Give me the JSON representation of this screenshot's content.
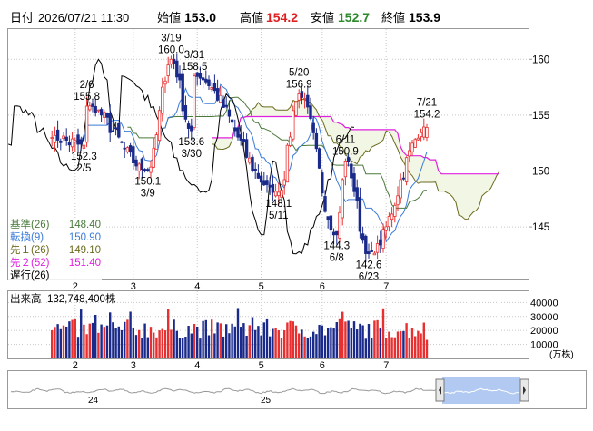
{
  "header": {
    "date_label": "日付",
    "datetime": "2026/07/21 11:30",
    "open_label": "始値",
    "open": "153.0",
    "high_label": "高値",
    "high": "154.2",
    "low_label": "安値",
    "low": "152.7",
    "close_label": "終値",
    "close": "153.9"
  },
  "legend": [
    {
      "label": "基準(26)",
      "value": "148.40",
      "color": "#4a7a3a"
    },
    {
      "label": "転換(9)",
      "value": "150.90",
      "color": "#3a7ad8"
    },
    {
      "label": "先１(26)",
      "value": "149.10",
      "color": "#6b6b1e"
    },
    {
      "label": "先２(52)",
      "value": "151.40",
      "color": "#e020e0"
    },
    {
      "label": "遅行(26)",
      "value": "",
      "color": "#000000"
    }
  ],
  "volume_header": {
    "label": "出来高",
    "value": "132,748,400株"
  },
  "volume_unit": "(万株)",
  "navigator_labels": [
    "24",
    "25"
  ],
  "colors": {
    "up": "#e83030",
    "down": "#1a2a8a",
    "base": "#4a7a3a",
    "conversion": "#3a7ad8",
    "span1": "#6b6b1e",
    "span2": "#e020e0",
    "lagging": "#000000",
    "cloud": "#f2f6e4",
    "grid": "#c8c8c8"
  },
  "chart_data": [
    {
      "type": "candlestick",
      "x_ticks": [
        "2",
        "3",
        "4",
        "5",
        "6",
        "7"
      ],
      "y_ticks": [
        145,
        150,
        155,
        160
      ],
      "ylim": [
        140.3,
        162.7
      ],
      "annotations": [
        {
          "date": "2/5",
          "value": 152.3,
          "text": [
            "152.3",
            "2/5"
          ]
        },
        {
          "date": "2/6",
          "value": 155.8,
          "text": [
            "2/6",
            "155.8"
          ]
        },
        {
          "date": "3/9",
          "value": 150.1,
          "text": [
            "150.1",
            "3/9"
          ]
        },
        {
          "date": "3/19",
          "value": 160.0,
          "text": [
            "3/19",
            "160.0"
          ]
        },
        {
          "date": "3/31",
          "value": 158.5,
          "text": [
            "3/31",
            "158.5"
          ]
        },
        {
          "date": "3/30",
          "value": 153.6,
          "text": [
            "153.6",
            "3/30"
          ]
        },
        {
          "date": "5/11",
          "value": 148.1,
          "text": [
            "148.1",
            "5/11"
          ]
        },
        {
          "date": "5/20",
          "value": 156.9,
          "text": [
            "5/20",
            "156.9"
          ]
        },
        {
          "date": "6/11",
          "value": 150.9,
          "text": [
            "6/11",
            "150.9"
          ]
        },
        {
          "date": "6/8",
          "value": 144.3,
          "text": [
            "144.3",
            "6/8"
          ]
        },
        {
          "date": "6/23",
          "value": 142.6,
          "text": [
            "142.6",
            "6/23"
          ]
        },
        {
          "date": "7/21",
          "value": 154.2,
          "text": [
            "7/21",
            "154.2"
          ]
        }
      ],
      "key_points": [
        {
          "date": "2/5",
          "close": 152.3
        },
        {
          "date": "2/6",
          "close": 155.8
        },
        {
          "date": "3/9",
          "close": 150.1
        },
        {
          "date": "3/19",
          "close": 160.0
        },
        {
          "date": "3/30",
          "close": 153.6
        },
        {
          "date": "3/31",
          "close": 158.5
        },
        {
          "date": "5/11",
          "close": 148.1
        },
        {
          "date": "5/20",
          "close": 156.9
        },
        {
          "date": "6/8",
          "close": 144.3
        },
        {
          "date": "6/11",
          "close": 150.9
        },
        {
          "date": "6/23",
          "close": 142.6
        },
        {
          "date": "7/21",
          "close": 153.9
        }
      ],
      "series": [
        {
          "name": "基準(26)",
          "last": 148.4
        },
        {
          "name": "転換(9)",
          "last": 150.9
        },
        {
          "name": "先１(26)",
          "last": 149.1
        },
        {
          "name": "先２(52)",
          "last": 151.4
        },
        {
          "name": "遅行(26)"
        }
      ]
    },
    {
      "type": "bar",
      "name": "出来高",
      "unit": "万株",
      "y_ticks": [
        10000,
        20000,
        30000,
        40000
      ],
      "ylim": [
        0,
        48000
      ],
      "x_ticks": [
        "2",
        "3",
        "4",
        "5",
        "6",
        "7"
      ]
    }
  ]
}
